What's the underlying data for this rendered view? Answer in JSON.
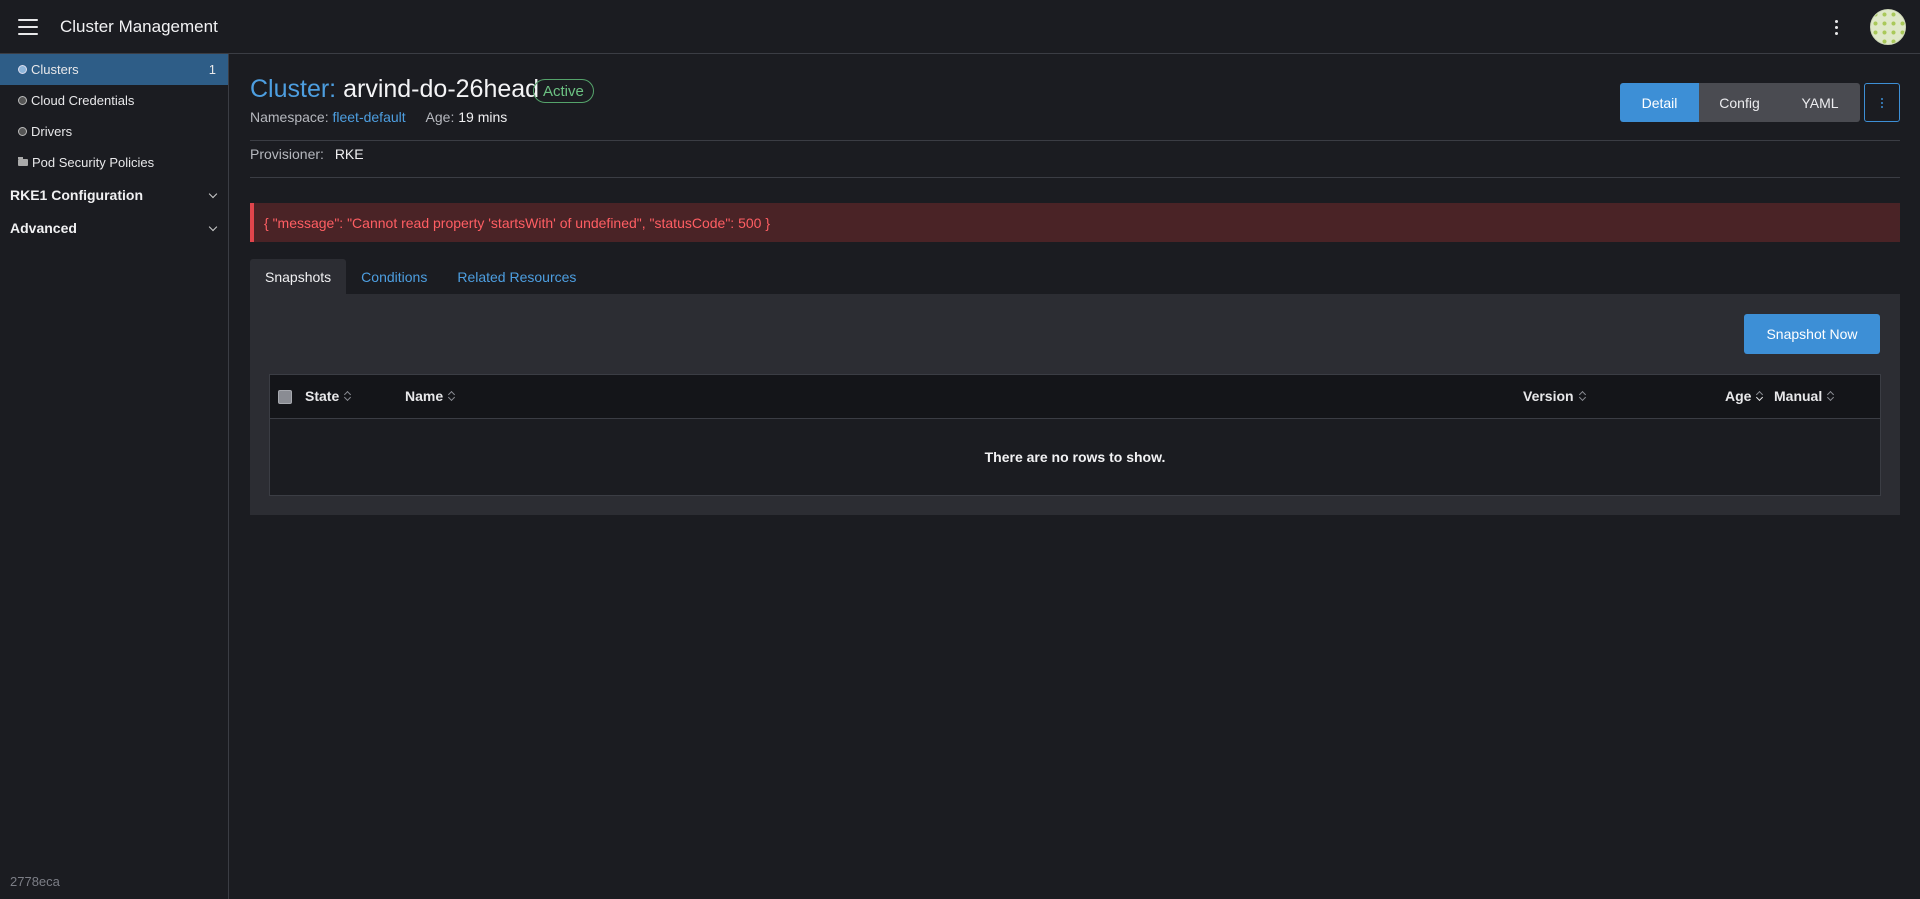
{
  "header": {
    "title": "Cluster Management",
    "icons": [
      "hamburger-menu-icon",
      "more-vertical-icon",
      "user-avatar"
    ]
  },
  "sidebar": {
    "items": [
      {
        "label": "Clusters",
        "icon": "circle-icon",
        "count": "1",
        "active": true
      },
      {
        "label": "Cloud Credentials",
        "icon": "circle-icon"
      },
      {
        "label": "Drivers",
        "icon": "circle-icon"
      },
      {
        "label": "Pod Security Policies",
        "icon": "folder-icon"
      }
    ],
    "groups": [
      {
        "label": "RKE1 Configuration",
        "expanded": false
      },
      {
        "label": "Advanced",
        "expanded": false
      }
    ],
    "version": "2778eca"
  },
  "cluster": {
    "prefix": "Cluster:",
    "name": "arvind-do-26head",
    "status": "Active",
    "namespace_label": "Namespace:",
    "namespace": "fleet-default",
    "age_label": "Age:",
    "age": "19 mins",
    "provisioner_label": "Provisioner:",
    "provisioner": "RKE"
  },
  "view_buttons": [
    "Detail",
    "Config",
    "YAML"
  ],
  "selected_view": "Detail",
  "error": "{ \"message\": \"Cannot read property 'startsWith' of undefined\", \"statusCode\": 500 }",
  "tabs": [
    "Snapshots",
    "Conditions",
    "Related Resources"
  ],
  "active_tab": "Snapshots",
  "snapshots": {
    "action": "Snapshot Now",
    "columns": [
      "State",
      "Name",
      "Version",
      "Age",
      "Manual"
    ],
    "sorted_column": "Age",
    "rows": [],
    "empty_message": "There are no rows to show."
  },
  "colors": {
    "accent": "#3d8fd6",
    "active_status": "#6cc283",
    "error": "#ff5e63",
    "background": "#1b1c21"
  }
}
